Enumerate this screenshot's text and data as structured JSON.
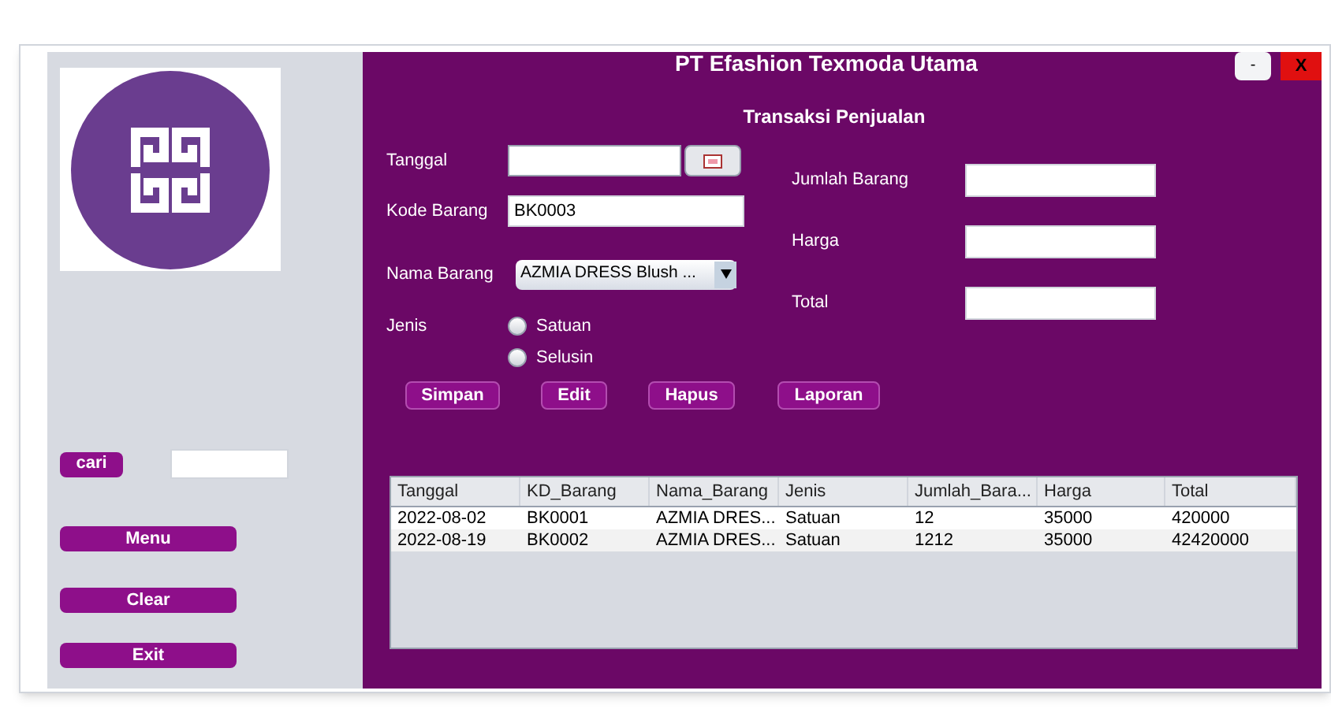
{
  "window": {
    "title": "PT Efashion Texmoda Utama",
    "buttons": [
      "-",
      "X"
    ]
  },
  "sidebar": {
    "search_button": "cari",
    "buttons": [
      "Menu",
      "Clear",
      "Exit"
    ]
  },
  "form": {
    "title": "Transaksi Penjualan",
    "tanggal": {
      "label": "Tanggal"
    },
    "kode_barang": {
      "label": "Kode Barang",
      "value": "BK0003"
    },
    "nama_barang": {
      "label": "Nama Barang",
      "value": "AZMIA DRESS Blush ..."
    },
    "jenis": {
      "label": "Jenis",
      "options": [
        {
          "label": "Satuan",
          "selected": false
        },
        {
          "label": "Selusin",
          "selected": false
        }
      ]
    },
    "jumlah_barang": {
      "label": "Jumlah Barang"
    },
    "harga": {
      "label": "Harga"
    },
    "total": {
      "label": "Total"
    },
    "buttons": [
      "Simpan",
      "Edit",
      "Hapus",
      "Laporan"
    ]
  },
  "table": {
    "columns": [
      "Tanggal",
      "KD_Barang",
      "Nama_Barang",
      "Jenis",
      "Jumlah_Bara...",
      "Harga",
      "Total"
    ],
    "rows": [
      [
        "2022-08-02",
        "BK0001",
        "AZMIA DRES...",
        "Satuan",
        "12",
        "35000",
        "420000"
      ],
      [
        "2022-08-19",
        "BK0002",
        "AZMIA DRES...",
        "Satuan",
        "1212",
        "35000",
        "42420000"
      ]
    ]
  }
}
